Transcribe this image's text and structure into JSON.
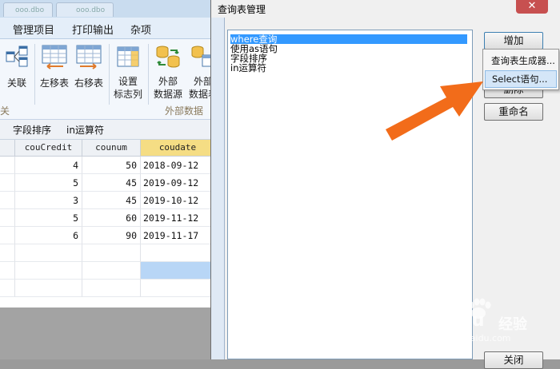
{
  "app": {
    "title_tabs": [
      "ooo.dbo",
      "ooo.dbo"
    ],
    "menu": [
      "管理项目",
      "打印输出",
      "杂项"
    ],
    "ribbon": {
      "buttons": [
        {
          "label": "关联",
          "icon": "relation-icon"
        },
        {
          "label": "左移表",
          "icon": "move-table-left-icon"
        },
        {
          "label": "右移表",
          "icon": "move-table-right-icon"
        },
        {
          "label_line1": "设置",
          "label_line2": "标志列",
          "icon": "flag-column-icon"
        },
        {
          "label_line1": "外部",
          "label_line2": "数据源",
          "icon": "external-datasource-icon"
        },
        {
          "label_line1": "外部",
          "label_line2": "数据表",
          "icon": "external-datatable-icon"
        }
      ],
      "group_left_label": "关",
      "group_external_label": "外部数据"
    },
    "subtabs": [
      "字段排序",
      "in运算符"
    ],
    "grid": {
      "columns": [
        "couCredit",
        "counum",
        "coudate"
      ],
      "rows": [
        {
          "couCredit": "4",
          "counum": "50",
          "coudate": "2018-09-12"
        },
        {
          "couCredit": "5",
          "counum": "45",
          "coudate": "2019-09-12"
        },
        {
          "couCredit": "3",
          "counum": "45",
          "coudate": "2019-10-12"
        },
        {
          "couCredit": "5",
          "counum": "60",
          "coudate": "2019-11-12"
        },
        {
          "couCredit": "6",
          "counum": "90",
          "coudate": "2019-11-17"
        }
      ]
    }
  },
  "dialog": {
    "title": "查询表管理",
    "close_glyph": "✕",
    "list_items": [
      "where查询",
      "使用as语句",
      "字段排序",
      "in运算符"
    ],
    "selected_index": 0,
    "buttons": {
      "add": "增加",
      "delete": "删除",
      "rename": "重命名",
      "close": "关闭"
    },
    "dropdown": {
      "items": [
        "查询表生成器...",
        "Select语句..."
      ],
      "hot_index": 1
    }
  },
  "annotation": {
    "arrow_color": "#f26c1a"
  },
  "watermark": {
    "brand": "Baidu",
    "brand_cn": "经验",
    "url": "jingyan.baidu.com"
  }
}
